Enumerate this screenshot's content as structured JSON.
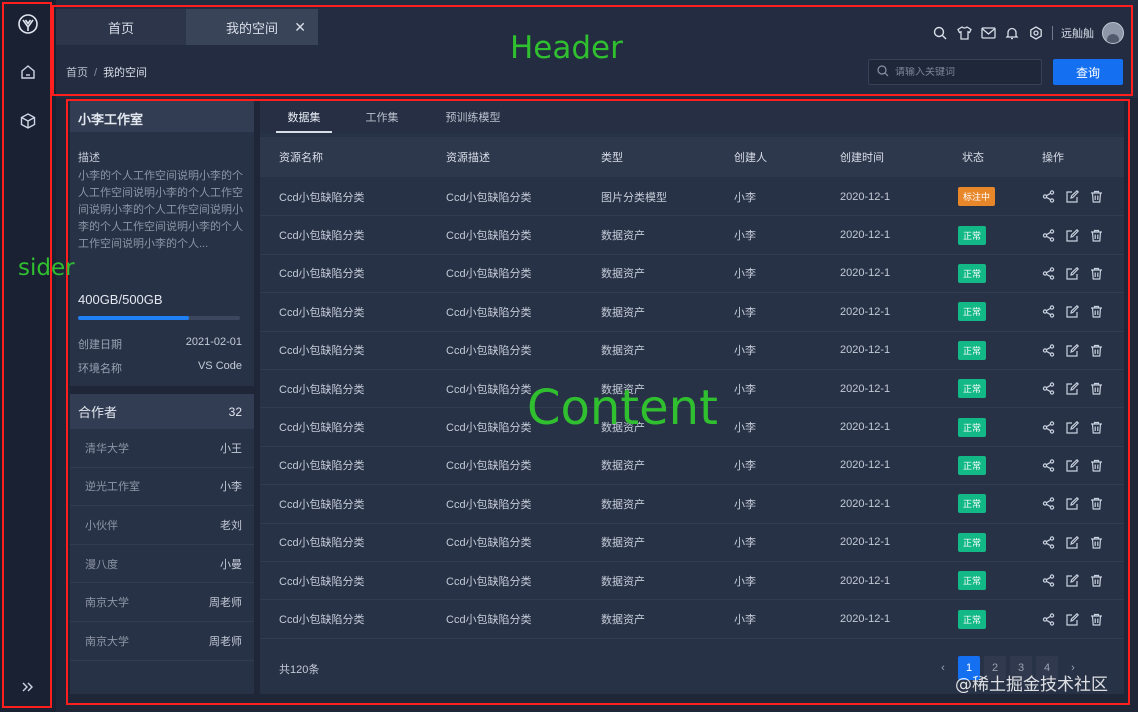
{
  "sider": {
    "logo_icon": "logo-icon",
    "items": [
      {
        "icon": "home-icon"
      },
      {
        "icon": "cube-icon"
      }
    ],
    "expand_icon": "double-chevron-right-icon"
  },
  "header": {
    "tabs": [
      {
        "label": "首页",
        "closable": false
      },
      {
        "label": "我的空间",
        "closable": true,
        "close_label": "✕"
      }
    ],
    "user_name": "远舢舢",
    "breadcrumb": {
      "root": "首页",
      "separator": "/",
      "current": "我的空间"
    },
    "search": {
      "placeholder": "请输入关键词",
      "value": ""
    },
    "query_button": "查询"
  },
  "studio": {
    "title": "小李工作室",
    "desc_label": "描述",
    "description": "小李的个人工作空间说明小李的个人工作空间说明小李的个人工作空间说明小李的个人工作空间说明小李的个人工作空间说明小李的个人工作空间说明小李的个人...",
    "usage": "400GB/500GB",
    "usage_fraction": 0.8,
    "created_label": "创建日期",
    "created_value": "2021-02-01",
    "env_label": "环境名称",
    "env_value": "VS Code"
  },
  "collaborators": {
    "title": "合作者",
    "count": "32",
    "items": [
      {
        "org": "清华大学",
        "person": "小王"
      },
      {
        "org": "逆光工作室",
        "person": "小李"
      },
      {
        "org": "小伙伴",
        "person": "老刘"
      },
      {
        "org": "漫八度",
        "person": "小曼"
      },
      {
        "org": "南京大学",
        "person": "周老师"
      },
      {
        "org": "南京大学",
        "person": "周老师"
      }
    ]
  },
  "content": {
    "tabs": [
      {
        "label": "数据集",
        "active": true
      },
      {
        "label": "工作集",
        "active": false
      },
      {
        "label": "预训练模型",
        "active": false
      }
    ],
    "columns": [
      "资源名称",
      "资源描述",
      "类型",
      "创建人",
      "创建时间",
      "状态",
      "操作"
    ],
    "rows": [
      {
        "name": "Ccd小包缺陷分类",
        "desc": "Ccd小包缺陷分类",
        "type": "图片分类模型",
        "creator": "小李",
        "time": "2020-12-1",
        "status": "标注中",
        "status_color": "#e8862a"
      },
      {
        "name": "Ccd小包缺陷分类",
        "desc": "Ccd小包缺陷分类",
        "type": "数据资产",
        "creator": "小李",
        "time": "2020-12-1",
        "status": "正常",
        "status_color": "#12b886"
      },
      {
        "name": "Ccd小包缺陷分类",
        "desc": "Ccd小包缺陷分类",
        "type": "数据资产",
        "creator": "小李",
        "time": "2020-12-1",
        "status": "正常",
        "status_color": "#12b886"
      },
      {
        "name": "Ccd小包缺陷分类",
        "desc": "Ccd小包缺陷分类",
        "type": "数据资产",
        "creator": "小李",
        "time": "2020-12-1",
        "status": "正常",
        "status_color": "#12b886"
      },
      {
        "name": "Ccd小包缺陷分类",
        "desc": "Ccd小包缺陷分类",
        "type": "数据资产",
        "creator": "小李",
        "time": "2020-12-1",
        "status": "正常",
        "status_color": "#12b886"
      },
      {
        "name": "Ccd小包缺陷分类",
        "desc": "Ccd小包缺陷分类",
        "type": "数据资产",
        "creator": "小李",
        "time": "2020-12-1",
        "status": "正常",
        "status_color": "#12b886"
      },
      {
        "name": "Ccd小包缺陷分类",
        "desc": "Ccd小包缺陷分类",
        "type": "数据资产",
        "creator": "小李",
        "time": "2020-12-1",
        "status": "正常",
        "status_color": "#12b886"
      },
      {
        "name": "Ccd小包缺陷分类",
        "desc": "Ccd小包缺陷分类",
        "type": "数据资产",
        "creator": "小李",
        "time": "2020-12-1",
        "status": "正常",
        "status_color": "#12b886"
      },
      {
        "name": "Ccd小包缺陷分类",
        "desc": "Ccd小包缺陷分类",
        "type": "数据资产",
        "creator": "小李",
        "time": "2020-12-1",
        "status": "正常",
        "status_color": "#12b886"
      },
      {
        "name": "Ccd小包缺陷分类",
        "desc": "Ccd小包缺陷分类",
        "type": "数据资产",
        "creator": "小李",
        "time": "2020-12-1",
        "status": "正常",
        "status_color": "#12b886"
      },
      {
        "name": "Ccd小包缺陷分类",
        "desc": "Ccd小包缺陷分类",
        "type": "数据资产",
        "creator": "小李",
        "time": "2020-12-1",
        "status": "正常",
        "status_color": "#12b886"
      },
      {
        "name": "Ccd小包缺陷分类",
        "desc": "Ccd小包缺陷分类",
        "type": "数据资产",
        "creator": "小李",
        "time": "2020-12-1",
        "status": "正常",
        "status_color": "#12b886"
      }
    ],
    "row_actions": [
      "share-icon",
      "edit-icon",
      "delete-icon"
    ],
    "total": "共120条",
    "pagination": {
      "prev": "‹",
      "pages": [
        "1",
        "2",
        "3",
        "4"
      ],
      "current": "1",
      "next": "›"
    }
  },
  "annotations": {
    "header": "Header",
    "sider": "sider",
    "content": "Content"
  },
  "watermark": "@稀土掘金技术社区",
  "colors": {
    "primary": "#1470f0",
    "annotation_border": "#ff1f1f",
    "annotation_text": "#2fbf2f"
  }
}
